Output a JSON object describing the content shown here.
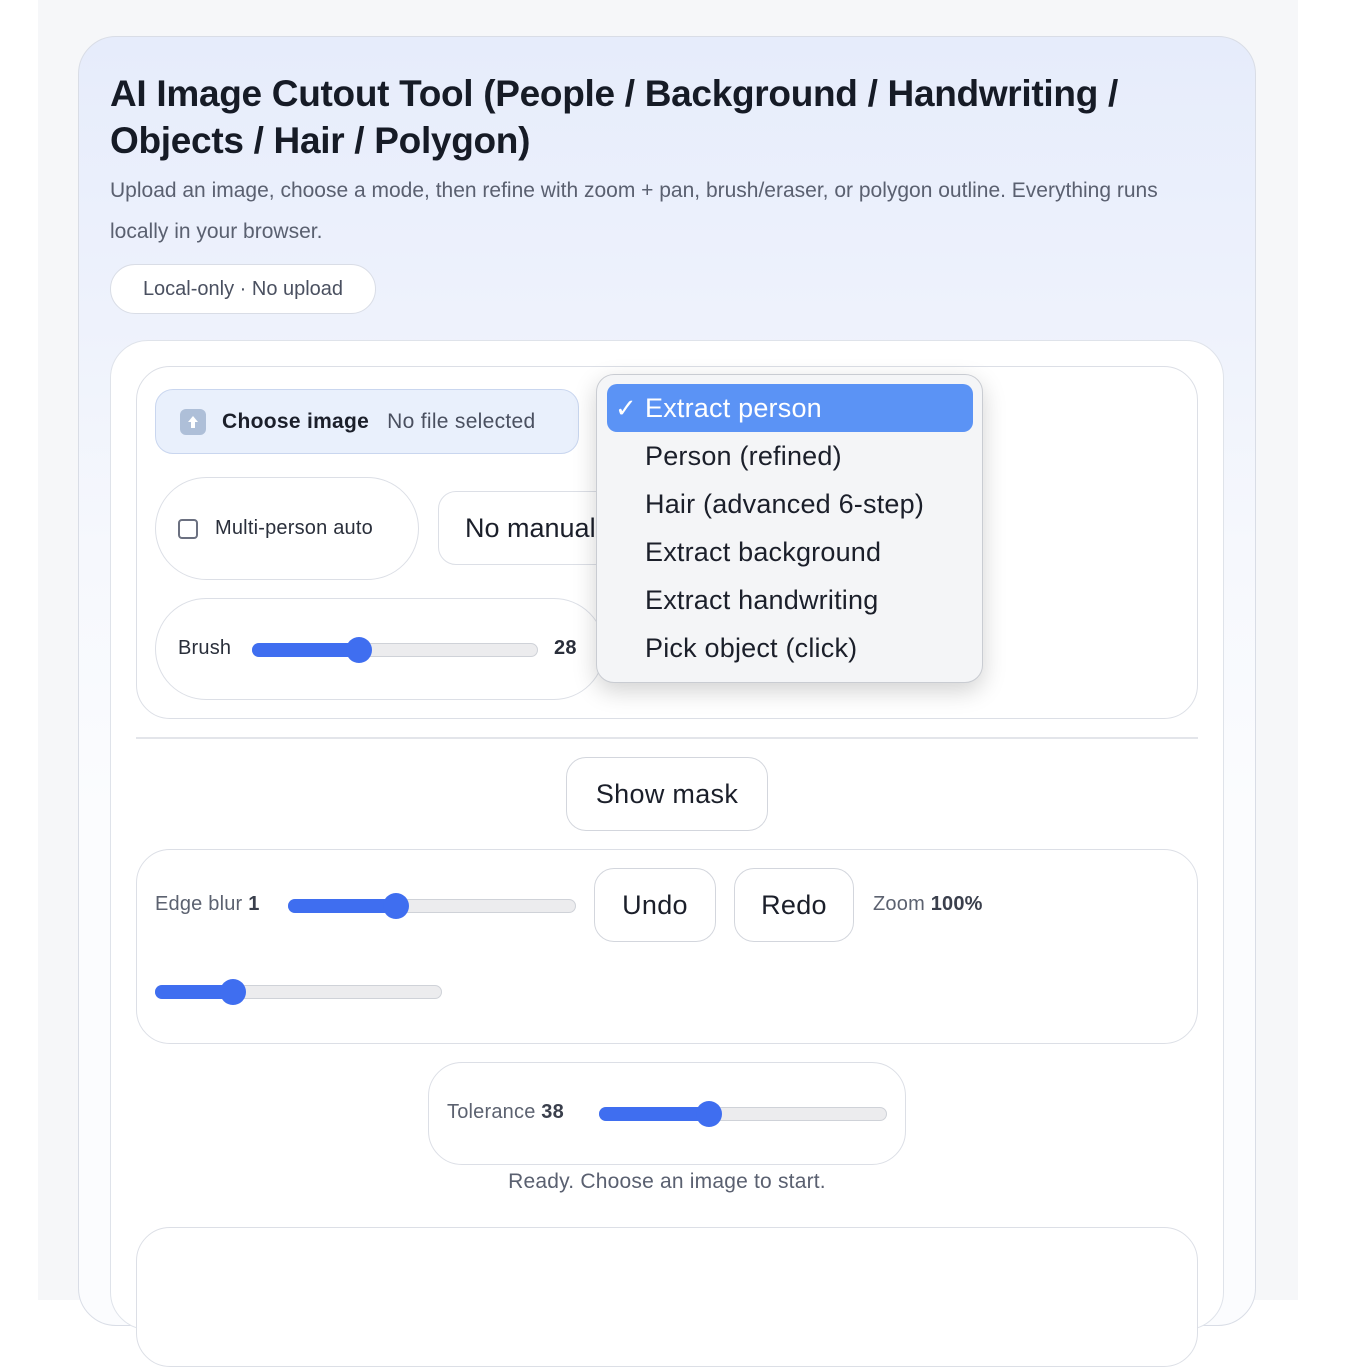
{
  "header": {
    "title": "AI Image Cutout Tool (People / Background / Handwriting / Objects / Hair / Polygon)",
    "subtitle": "Upload an image, choose a mode, then refine with zoom + pan, brush/eraser, or polygon outline. Everything runs locally in your browser.",
    "badge": "Local-only · No upload"
  },
  "controls": {
    "file_button_label": "Choose image",
    "file_status": "No file selected",
    "multi_person_label": "Multi-person auto",
    "multi_person_checked": false,
    "manual_select_value": "No manual tool",
    "brush_label": "Brush",
    "brush_value": "28",
    "brush_fraction": 0.37
  },
  "mode_dropdown": {
    "selected_index": 0,
    "check_glyph": "✓",
    "options": [
      "Extract person",
      "Person (refined)",
      "Hair (advanced 6-step)",
      "Extract background",
      "Extract handwriting",
      "Pick object (click)"
    ]
  },
  "show_mask_label": "Show mask",
  "refine": {
    "edge_blur_label": "Edge blur",
    "edge_blur_value": "1",
    "edge_blur_fraction": 0.37,
    "undo_label": "Undo",
    "redo_label": "Redo",
    "zoom_label": "Zoom",
    "zoom_value": "100%",
    "second_slider_fraction": 0.27
  },
  "tolerance": {
    "label": "Tolerance",
    "value": "38",
    "fraction": 0.38
  },
  "status_text": "Ready. Choose an image to start.",
  "colors": {
    "accent": "#3f6ef0",
    "dropdown_selected": "#5b93f5"
  },
  "icons": {
    "upload": "up-arrow-icon"
  }
}
